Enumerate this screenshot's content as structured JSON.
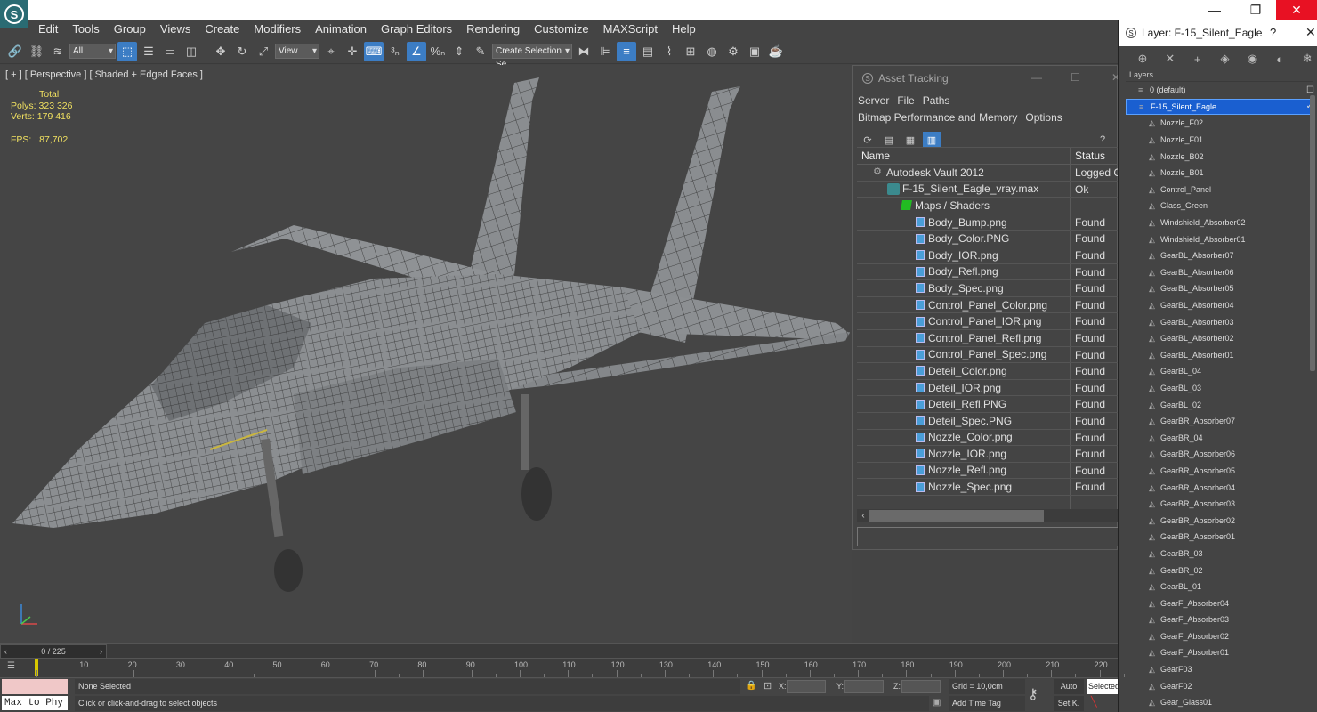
{
  "menu": [
    "Edit",
    "Tools",
    "Group",
    "Views",
    "Create",
    "Modifiers",
    "Animation",
    "Graph Editors",
    "Rendering",
    "Customize",
    "MAXScript",
    "Help"
  ],
  "toolbar": {
    "filter_value": "All",
    "refcoord_value": "View",
    "named_selection_placeholder": "Create Selection Se"
  },
  "viewport": {
    "label": "[ + ] [ Perspective ] [ Shaded + Edged Faces ]",
    "stats_title": "Total",
    "polys_label": "Polys:",
    "polys_value": "323 326",
    "verts_label": "Verts:",
    "verts_value": "179 416",
    "fps_label": "FPS:",
    "fps_value": "87,702"
  },
  "asset_tracking": {
    "title": "Asset Tracking",
    "menu": [
      "Server",
      "File",
      "Paths",
      "Bitmap Performance and Memory",
      "Options"
    ],
    "col_name": "Name",
    "col_status": "Status",
    "rows": [
      {
        "name": "Autodesk Vault 2012",
        "status": "Logged C",
        "level": 0,
        "kind": "vault"
      },
      {
        "name": "F-15_Silent_Eagle_vray.max",
        "status": "Ok",
        "level": 1,
        "kind": "max"
      },
      {
        "name": "Maps / Shaders",
        "status": "",
        "level": 2,
        "kind": "maps"
      },
      {
        "name": "Body_Bump.png",
        "status": "Found",
        "level": 3,
        "kind": "file"
      },
      {
        "name": "Body_Color.PNG",
        "status": "Found",
        "level": 3,
        "kind": "file"
      },
      {
        "name": "Body_IOR.png",
        "status": "Found",
        "level": 3,
        "kind": "file"
      },
      {
        "name": "Body_Refl.png",
        "status": "Found",
        "level": 3,
        "kind": "file"
      },
      {
        "name": "Body_Spec.png",
        "status": "Found",
        "level": 3,
        "kind": "file"
      },
      {
        "name": "Control_Panel_Color.png",
        "status": "Found",
        "level": 3,
        "kind": "file"
      },
      {
        "name": "Control_Panel_IOR.png",
        "status": "Found",
        "level": 3,
        "kind": "file"
      },
      {
        "name": "Control_Panel_Refl.png",
        "status": "Found",
        "level": 3,
        "kind": "file"
      },
      {
        "name": "Control_Panel_Spec.png",
        "status": "Found",
        "level": 3,
        "kind": "file"
      },
      {
        "name": "Deteil_Color.png",
        "status": "Found",
        "level": 3,
        "kind": "file"
      },
      {
        "name": "Deteil_IOR.png",
        "status": "Found",
        "level": 3,
        "kind": "file"
      },
      {
        "name": "Deteil_Refl.PNG",
        "status": "Found",
        "level": 3,
        "kind": "file"
      },
      {
        "name": "Deteil_Spec.PNG",
        "status": "Found",
        "level": 3,
        "kind": "file"
      },
      {
        "name": "Nozzle_Color.png",
        "status": "Found",
        "level": 3,
        "kind": "file"
      },
      {
        "name": "Nozzle_IOR.png",
        "status": "Found",
        "level": 3,
        "kind": "file"
      },
      {
        "name": "Nozzle_Refl.png",
        "status": "Found",
        "level": 3,
        "kind": "file"
      },
      {
        "name": "Nozzle_Spec.png",
        "status": "Found",
        "level": 3,
        "kind": "file"
      }
    ]
  },
  "layers": {
    "title": "Layer: F-15_Silent_Eagle",
    "help": "?",
    "header": "Layers",
    "items": [
      {
        "name": "0 (default)",
        "kind": "layer",
        "selected": false
      },
      {
        "name": "F-15_Silent_Eagle",
        "kind": "layer",
        "selected": true
      },
      {
        "name": "Nozzle_F02",
        "kind": "obj"
      },
      {
        "name": "Nozzle_F01",
        "kind": "obj"
      },
      {
        "name": "Nozzle_B02",
        "kind": "obj"
      },
      {
        "name": "Nozzle_B01",
        "kind": "obj"
      },
      {
        "name": "Control_Panel",
        "kind": "obj"
      },
      {
        "name": "Glass_Green",
        "kind": "obj"
      },
      {
        "name": "Windshield_Absorber02",
        "kind": "obj"
      },
      {
        "name": "Windshield_Absorber01",
        "kind": "obj"
      },
      {
        "name": "GearBL_Absorber07",
        "kind": "obj"
      },
      {
        "name": "GearBL_Absorber06",
        "kind": "obj"
      },
      {
        "name": "GearBL_Absorber05",
        "kind": "obj"
      },
      {
        "name": "GearBL_Absorber04",
        "kind": "obj"
      },
      {
        "name": "GearBL_Absorber03",
        "kind": "obj"
      },
      {
        "name": "GearBL_Absorber02",
        "kind": "obj"
      },
      {
        "name": "GearBL_Absorber01",
        "kind": "obj"
      },
      {
        "name": "GearBL_04",
        "kind": "obj"
      },
      {
        "name": "GearBL_03",
        "kind": "obj"
      },
      {
        "name": "GearBL_02",
        "kind": "obj"
      },
      {
        "name": "GearBR_Absorber07",
        "kind": "obj"
      },
      {
        "name": "GearBR_04",
        "kind": "obj"
      },
      {
        "name": "GearBR_Absorber06",
        "kind": "obj"
      },
      {
        "name": "GearBR_Absorber05",
        "kind": "obj"
      },
      {
        "name": "GearBR_Absorber04",
        "kind": "obj"
      },
      {
        "name": "GearBR_Absorber03",
        "kind": "obj"
      },
      {
        "name": "GearBR_Absorber02",
        "kind": "obj"
      },
      {
        "name": "GearBR_Absorber01",
        "kind": "obj"
      },
      {
        "name": "GearBR_03",
        "kind": "obj"
      },
      {
        "name": "GearBR_02",
        "kind": "obj"
      },
      {
        "name": "GearBL_01",
        "kind": "obj"
      },
      {
        "name": "GearF_Absorber04",
        "kind": "obj"
      },
      {
        "name": "GearF_Absorber03",
        "kind": "obj"
      },
      {
        "name": "GearF_Absorber02",
        "kind": "obj"
      },
      {
        "name": "GearF_Absorber01",
        "kind": "obj"
      },
      {
        "name": "GearF03",
        "kind": "obj"
      },
      {
        "name": "GearF02",
        "kind": "obj"
      },
      {
        "name": "Gear_Glass01",
        "kind": "obj"
      }
    ]
  },
  "timeline": {
    "frame_display": "0 / 225",
    "ticks": [
      "10",
      "20",
      "30",
      "40",
      "50",
      "60",
      "70",
      "80",
      "90",
      "100",
      "110",
      "120",
      "130",
      "140",
      "150",
      "160",
      "170",
      "180",
      "190",
      "200",
      "210",
      "220"
    ]
  },
  "status": {
    "maxscript_label": "Max to Phy",
    "selection": "None Selected",
    "prompt": "Click or click-and-drag to select objects",
    "x_label": "X:",
    "y_label": "Y:",
    "z_label": "Z:",
    "grid": "Grid = 10,0cm",
    "add_time_tag": "Add Time Tag",
    "auto": "Auto",
    "set_key": "Set K.",
    "selected_dd": "Selected"
  },
  "colors": {
    "accent": "#3c7dc4",
    "stats": "#f0e060",
    "selection": "#1a5fd0"
  }
}
